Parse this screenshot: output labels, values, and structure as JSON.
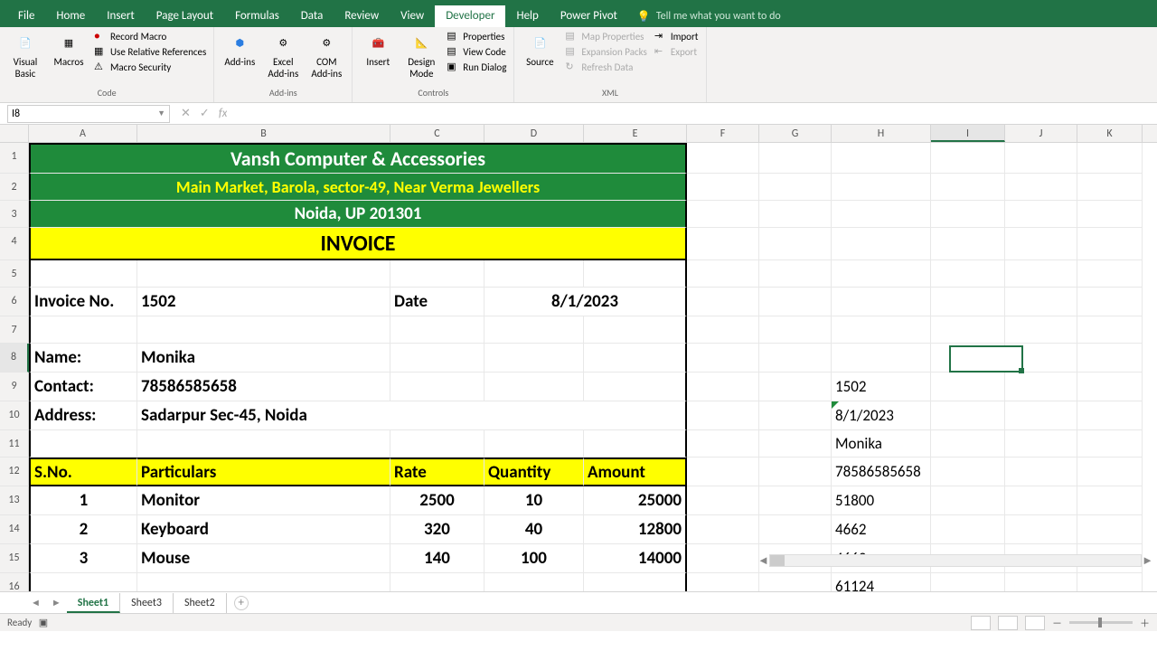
{
  "app": {
    "active_tab": "Developer"
  },
  "tabs": [
    "File",
    "Home",
    "Insert",
    "Page Layout",
    "Formulas",
    "Data",
    "Review",
    "View",
    "Developer",
    "Help",
    "Power Pivot"
  ],
  "tellme": "Tell me what you want to do",
  "ribbon": {
    "code": {
      "visual_basic": "Visual Basic",
      "macros": "Macros",
      "record": "Record Macro",
      "use_rel": "Use Relative References",
      "security": "Macro Security",
      "label": "Code"
    },
    "addins": {
      "addins": "Add-ins",
      "excel": "Excel Add-ins",
      "com": "COM Add-ins",
      "label": "Add-ins"
    },
    "controls": {
      "insert": "Insert",
      "design": "Design Mode",
      "properties": "Properties",
      "view_code": "View Code",
      "run_dialog": "Run Dialog",
      "label": "Controls"
    },
    "xml": {
      "source": "Source",
      "map_props": "Map Properties",
      "expansion": "Expansion Packs",
      "refresh": "Refresh Data",
      "import": "Import",
      "export": "Export",
      "label": "XML"
    }
  },
  "namebox": "I8",
  "columns": [
    "A",
    "B",
    "C",
    "D",
    "E",
    "F",
    "G",
    "H",
    "I",
    "J",
    "K"
  ],
  "sheet": {
    "company": "Vansh Computer & Accessories",
    "address1": "Main Market, Barola, sector-49, Near Verma Jewellers",
    "address2": "Noida, UP 201301",
    "invoice_title": "INVOICE",
    "invoice_no_label": "Invoice No.",
    "invoice_no": "1502",
    "date_label": "Date",
    "date": "8/1/2023",
    "name_label": "Name:",
    "name": "Monika",
    "contact_label": "Contact:",
    "contact": "78586585658",
    "address_label": "Address:",
    "address": "Sadarpur Sec-45, Noida",
    "th": {
      "sno": "S.No.",
      "part": "Particulars",
      "rate": "Rate",
      "qty": "Quantity",
      "amt": "Amount"
    },
    "items": [
      {
        "sno": "1",
        "part": "Monitor",
        "rate": "2500",
        "qty": "10",
        "amt": "25000"
      },
      {
        "sno": "2",
        "part": "Keyboard",
        "rate": "320",
        "qty": "40",
        "amt": "12800"
      },
      {
        "sno": "3",
        "part": "Mouse",
        "rate": "140",
        "qty": "100",
        "amt": "14000"
      }
    ],
    "aux": {
      "h9": "1502",
      "h10": "8/1/2023",
      "h11": "Monika",
      "h12": "78586585658",
      "h13": "51800",
      "h14": "4662",
      "h15": "4662",
      "h16": "61124"
    }
  },
  "tabs_bottom": [
    "Sheet1",
    "Sheet3",
    "Sheet2"
  ],
  "status": "Ready",
  "rows": [
    "1",
    "2",
    "3",
    "4",
    "5",
    "6",
    "7",
    "8",
    "9",
    "10",
    "11",
    "12",
    "13",
    "14",
    "15",
    "16"
  ]
}
